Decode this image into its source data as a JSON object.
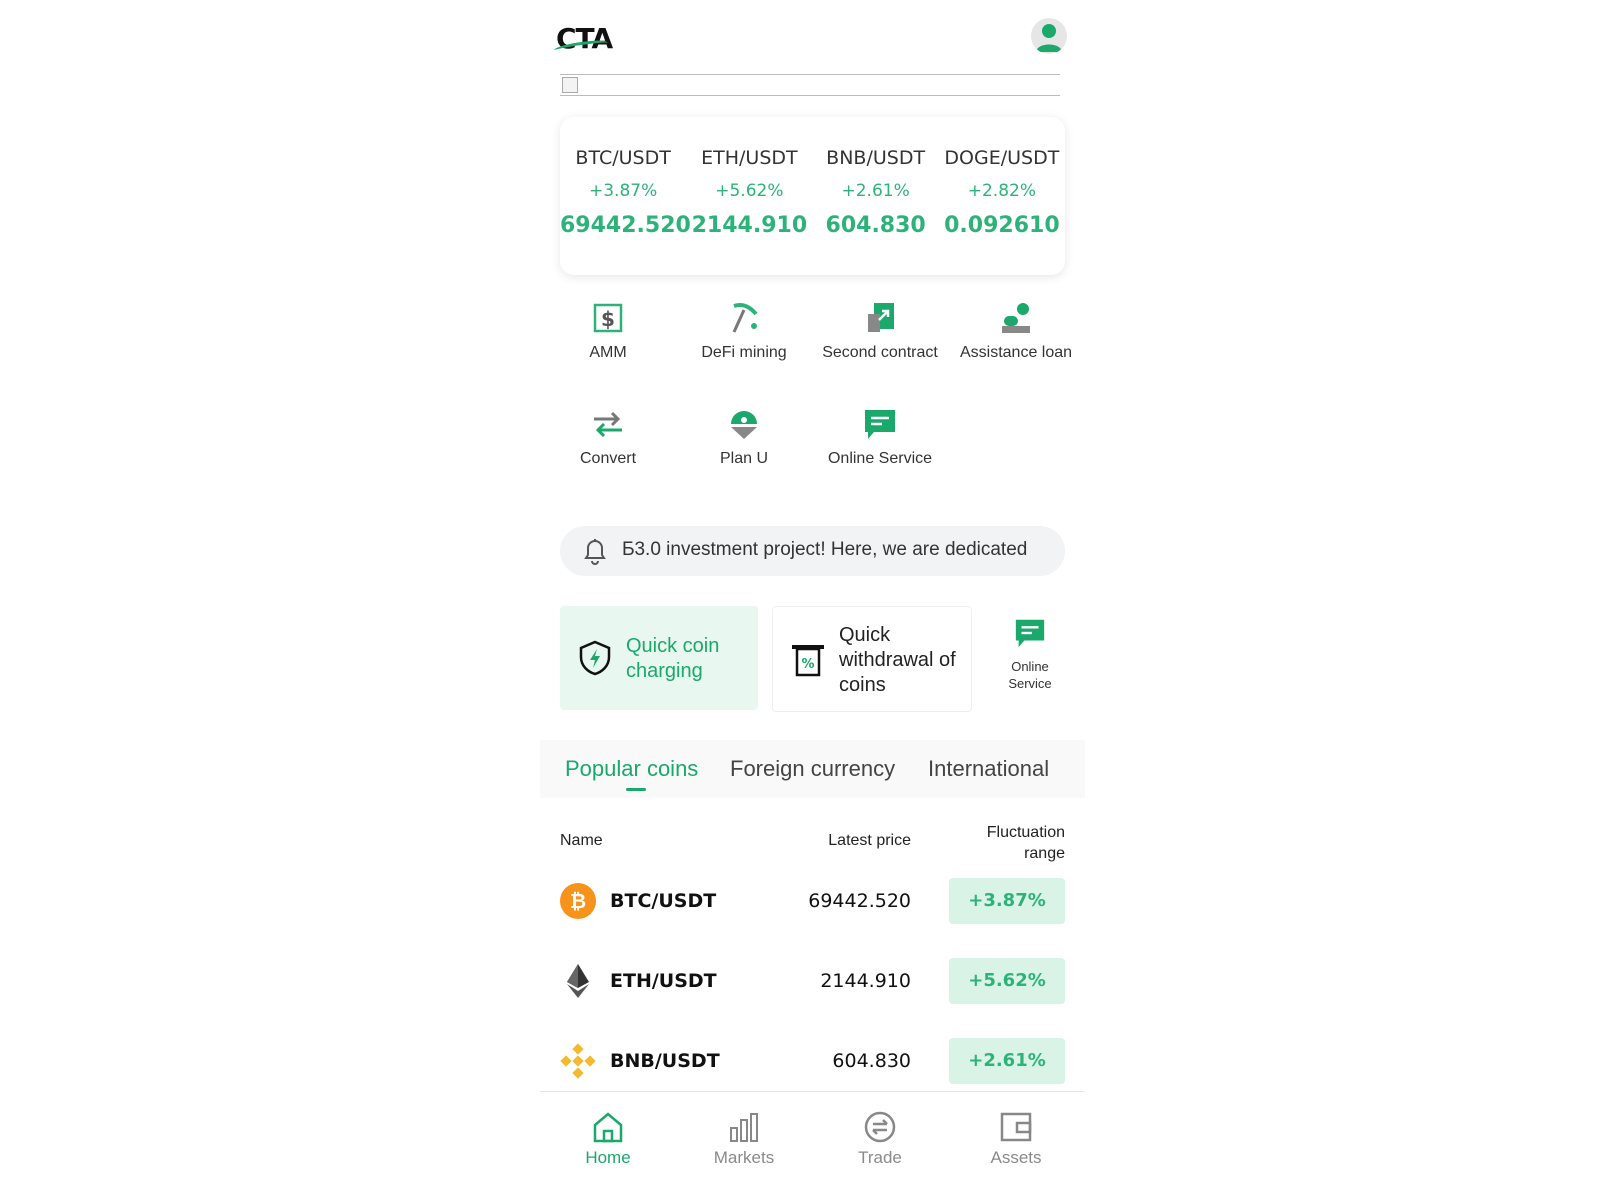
{
  "header": {
    "logo_text": "CTA"
  },
  "ticker": [
    {
      "pair": "BTC/USDT",
      "change": "+3.87%",
      "price": "69442.520"
    },
    {
      "pair": "ETH/USDT",
      "change": "+5.62%",
      "price": "2144.910"
    },
    {
      "pair": "BNB/USDT",
      "change": "+2.61%",
      "price": "604.830"
    },
    {
      "pair": "DOGE/USDT",
      "change": "+2.82%",
      "price": "0.092610"
    }
  ],
  "shortcuts": [
    {
      "label": "AMM",
      "icon": "dollar-exchange-icon"
    },
    {
      "label": "DeFi mining",
      "icon": "pickaxe-icon"
    },
    {
      "label": "Second contract",
      "icon": "contract-icon"
    },
    {
      "label": "Assistance loan",
      "icon": "loan-icon"
    },
    {
      "label": "Convert",
      "icon": "convert-arrows-icon"
    },
    {
      "label": "Plan U",
      "icon": "plan-u-icon"
    },
    {
      "label": "Online Service",
      "icon": "chat-icon"
    }
  ],
  "notice": {
    "text": "Ƃ3.0 investment project! Here, we are dedicated"
  },
  "actions": {
    "quick_charge": "Quick coin charging",
    "quick_withdraw": "Quick withdrawal of coins",
    "online_service": "Online Service"
  },
  "tabs": [
    "Popular coins",
    "Foreign currency",
    "International"
  ],
  "table": {
    "headers": {
      "name": "Name",
      "price": "Latest price",
      "range": "Fluctuation range"
    },
    "rows": [
      {
        "pair": "BTC/USDT",
        "price": "69442.520",
        "change": "+3.87%",
        "icon": "bitcoin-icon"
      },
      {
        "pair": "ETH/USDT",
        "price": "2144.910",
        "change": "+5.62%",
        "icon": "ethereum-icon"
      },
      {
        "pair": "BNB/USDT",
        "price": "604.830",
        "change": "+2.61%",
        "icon": "bnb-icon"
      }
    ]
  },
  "bottom_nav": [
    {
      "label": "Home",
      "active": true
    },
    {
      "label": "Markets",
      "active": false
    },
    {
      "label": "Trade",
      "active": false
    },
    {
      "label": "Assets",
      "active": false
    }
  ],
  "colors": {
    "accent": "#1aa86b",
    "up": "#2db37a",
    "up_bg": "#d9f3e6"
  }
}
